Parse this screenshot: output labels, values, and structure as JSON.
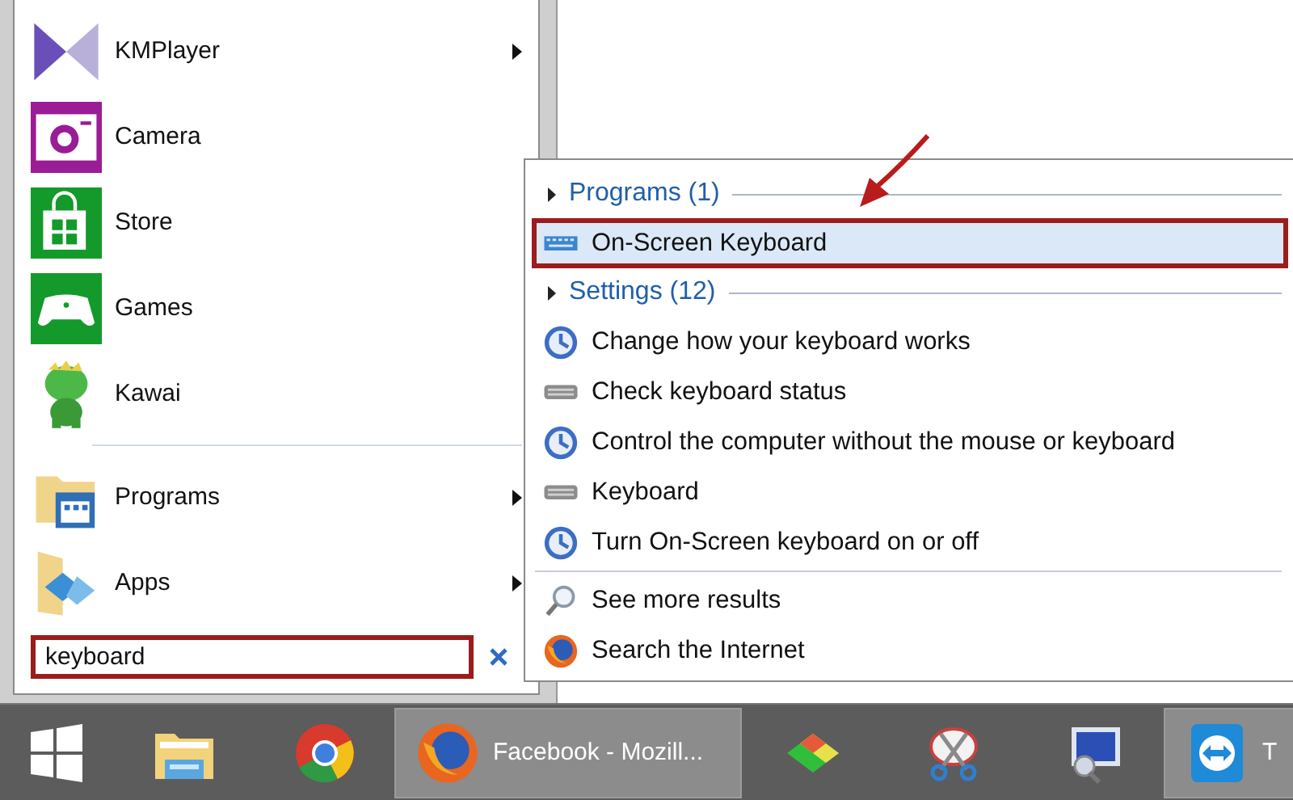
{
  "start_menu": {
    "apps": [
      {
        "label": "KMPlayer",
        "kind": "kmplayer",
        "submenu": true
      },
      {
        "label": "Camera",
        "kind": "camera",
        "submenu": false
      },
      {
        "label": "Store",
        "kind": "store",
        "submenu": false
      },
      {
        "label": "Games",
        "kind": "games",
        "submenu": false
      },
      {
        "label": "Kawai",
        "kind": "kawai",
        "submenu": false
      }
    ],
    "places": [
      {
        "label": "Programs",
        "kind": "programs",
        "submenu": true
      },
      {
        "label": "Apps",
        "kind": "apps",
        "submenu": true
      }
    ],
    "search": {
      "value": "keyboard",
      "highlighted": true
    }
  },
  "results": {
    "groups": [
      {
        "title": "Programs (1)",
        "items": [
          {
            "label": "On-Screen Keyboard",
            "kind": "keyboard",
            "selected": true,
            "highlighted": true
          }
        ]
      },
      {
        "title": "Settings (12)",
        "items": [
          {
            "label": "Change how your keyboard works",
            "kind": "dial",
            "selected": false,
            "highlighted": false
          },
          {
            "label": "Check keyboard status",
            "kind": "graykeyboard",
            "selected": false,
            "highlighted": false
          },
          {
            "label": "Control the computer without the mouse or keyboard",
            "kind": "dial",
            "selected": false,
            "highlighted": false
          },
          {
            "label": "Keyboard",
            "kind": "graykeyboard",
            "selected": false,
            "highlighted": false
          },
          {
            "label": "Turn On-Screen keyboard on or off",
            "kind": "dial",
            "selected": false,
            "highlighted": false
          }
        ]
      }
    ],
    "footer": [
      {
        "label": "See more results",
        "kind": "search"
      },
      {
        "label": "Search the Internet",
        "kind": "firefox"
      }
    ]
  },
  "taskbar": {
    "items": [
      {
        "kind": "start"
      },
      {
        "kind": "explorer"
      },
      {
        "kind": "chrome"
      },
      {
        "kind": "firefox",
        "label": "Facebook - Mozill..."
      },
      {
        "kind": "colors"
      },
      {
        "kind": "scissors"
      },
      {
        "kind": "monitor"
      },
      {
        "kind": "teamviewer",
        "label": "T"
      }
    ]
  }
}
